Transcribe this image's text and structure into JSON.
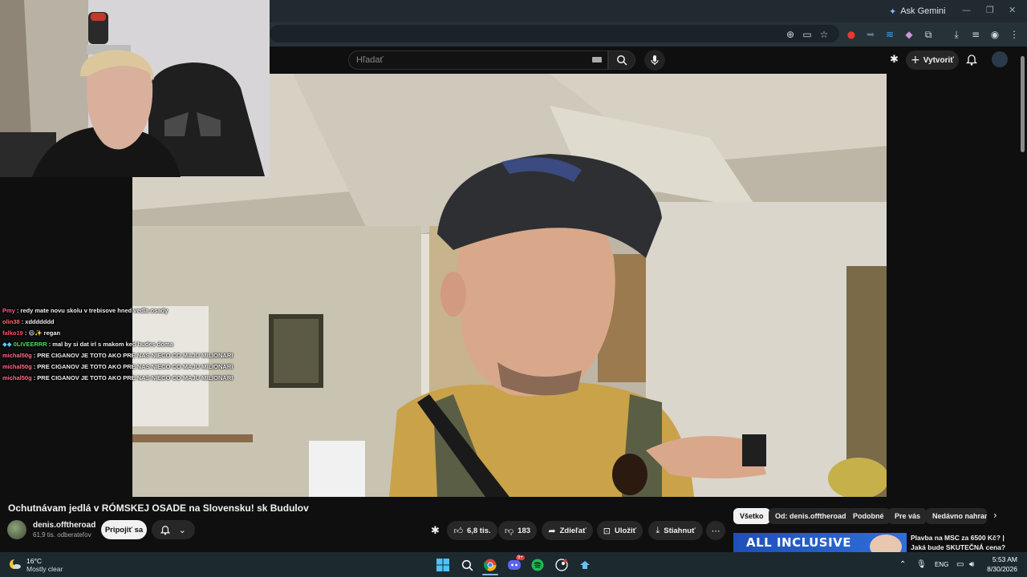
{
  "browser": {
    "ask_gemini": "Ask Gemini",
    "window_controls": [
      "—",
      "❐",
      "✕"
    ]
  },
  "youtube": {
    "search_placeholder": "Hľadať",
    "create_label": "Vytvoriť",
    "video": {
      "title": "Ochutnávam jedlá v RÓMSKEJ OSADE na Slovensku! sk Budulov",
      "channel": "denis.offtheroad",
      "subscribers": "61,9 tis. odberateľov",
      "join_label": "Pripojiť sa",
      "likes": "6,8 tis.",
      "dislikes": "183",
      "share_label": "Zdieľať",
      "save_label": "Uložiť",
      "download_label": "Stiahnuť"
    },
    "chips": [
      "Všetko",
      "Od: denis.offtheroad",
      "Podobné",
      "Pre vás",
      "Nedávno nahran"
    ],
    "recommended": {
      "thumb_text": "ALL INCLUSIVE",
      "title": "Plavba na MSC za 6500 Kč? | Jaká bude SKUTEČNÁ cena? |"
    }
  },
  "chat": [
    {
      "user": "Pmy",
      "color": "#ff5a8a",
      "message": ": redy mate novu skolu v trebisove hned vedla osady"
    },
    {
      "user": "olin38",
      "color": "#ff6b6b",
      "message": ": xddddddd"
    },
    {
      "user": "falko19",
      "color": "#ff4d6d",
      "message": ": 😄✨ regan"
    },
    {
      "user": "0LIVEERRR",
      "color": "#4cd964",
      "message": ": mal by si dat irl s makom ked budes doma"
    },
    {
      "user": "michal50g",
      "color": "#ff6b8a",
      "message": ": PRE CIGANOV JE TOTO AKO PRE NAS NIECO CO MAJU MILIONARI"
    },
    {
      "user": "michal50g",
      "color": "#ff6b8a",
      "message": ": PRE CIGANOV JE TOTO AKO PRE NAS NIECO CO MAJU MILIONARI"
    },
    {
      "user": "michal50g",
      "color": "#ff6b8a",
      "message": ": PRE CIGANOV JE TOTO AKO PRE NAS NIECO CO MAJU MILIONARI"
    }
  ],
  "taskbar": {
    "weather_temp": "16°C",
    "weather_desc": "Mostly clear",
    "language": "ENG",
    "time": "5:53 AM",
    "date": "8/30/2026",
    "discord_badge": "9+"
  }
}
